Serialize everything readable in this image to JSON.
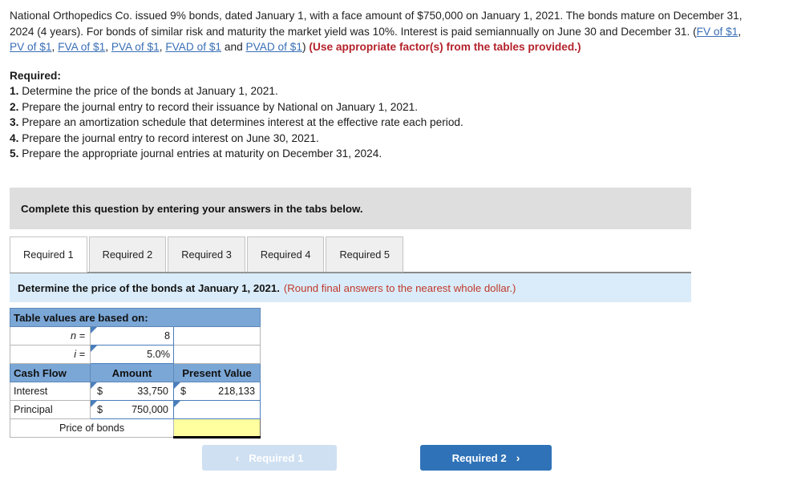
{
  "problem": {
    "segments": [
      {
        "type": "text",
        "value": "National Orthopedics Co. issued 9% bonds, dated January 1, with a face amount of $750,000 on January 1, 2021. The bonds mature on December 31, 2024 (4 years). For bonds of similar risk and maturity the market yield was 10%. Interest is paid semiannually on June 30 and December 31. ("
      },
      {
        "type": "link",
        "value": "FV of $1"
      },
      {
        "type": "text",
        "value": ", "
      },
      {
        "type": "link",
        "value": "PV of $1"
      },
      {
        "type": "text",
        "value": ", "
      },
      {
        "type": "link",
        "value": "FVA of $1"
      },
      {
        "type": "text",
        "value": ", "
      },
      {
        "type": "link",
        "value": "PVA of $1"
      },
      {
        "type": "text",
        "value": ", "
      },
      {
        "type": "link",
        "value": "FVAD of $1"
      },
      {
        "type": "text",
        "value": " and "
      },
      {
        "type": "link",
        "value": "PVAD of $1"
      },
      {
        "type": "text",
        "value": ") "
      },
      {
        "type": "redbold",
        "value": "(Use appropriate factor(s) from the tables provided.)"
      }
    ],
    "link_color": "#3a6fb5",
    "emphasis_color": "#b4232c"
  },
  "required": {
    "heading": "Required:",
    "items": [
      {
        "num": "1.",
        "text": "Determine the price of the bonds at January 1, 2021."
      },
      {
        "num": "2.",
        "text": "Prepare the journal entry to record their issuance by National on January 1, 2021."
      },
      {
        "num": "3.",
        "text": "Prepare an amortization schedule that determines interest at the effective rate each period."
      },
      {
        "num": "4.",
        "text": "Prepare the journal entry to record interest on June 30, 2021."
      },
      {
        "num": "5.",
        "text": "Prepare the appropriate journal entries at maturity on December 31, 2024."
      }
    ]
  },
  "instruction_bar": {
    "text": "Complete this question by entering your answers in the tabs below.",
    "background": "#dedede"
  },
  "tabs": {
    "items": [
      {
        "label": "Required 1",
        "active": true
      },
      {
        "label": "Required 2",
        "active": false
      },
      {
        "label": "Required 3",
        "active": false
      },
      {
        "label": "Required 4",
        "active": false
      },
      {
        "label": "Required 5",
        "active": false
      }
    ]
  },
  "task_bar": {
    "text": "Determine the price of the bonds at January 1, 2021.",
    "note": "(Round final answers to the nearest whole dollar.)",
    "background": "#daecf9",
    "note_color": "#c0392b"
  },
  "sheet": {
    "title": "Table values are based on:",
    "n_label": "n =",
    "n_value": "8",
    "i_label": "i =",
    "i_value": "5.0%",
    "columns": {
      "cash_flow": "Cash Flow",
      "amount": "Amount",
      "present_value": "Present Value"
    },
    "rows": [
      {
        "label": "Interest",
        "amount_symbol": "$",
        "amount_value": "33,750",
        "pv_symbol": "$",
        "pv_value": "218,133"
      },
      {
        "label": "Principal",
        "amount_symbol": "$",
        "amount_value": "750,000",
        "pv_symbol": "",
        "pv_value": ""
      }
    ],
    "total_label": "Price of bonds",
    "total_value": "",
    "header_color": "#7ba7d7",
    "answer_cell_color": "#ffffa0"
  },
  "nav": {
    "prev_label": "Required 1",
    "prev_icon": "chevron-left-icon",
    "prev_chevron": "‹",
    "next_label": "Required 2",
    "next_icon": "chevron-right-icon",
    "next_chevron": "›",
    "next_color": "#2f72b8",
    "prev_color": "#cfe0f2"
  }
}
